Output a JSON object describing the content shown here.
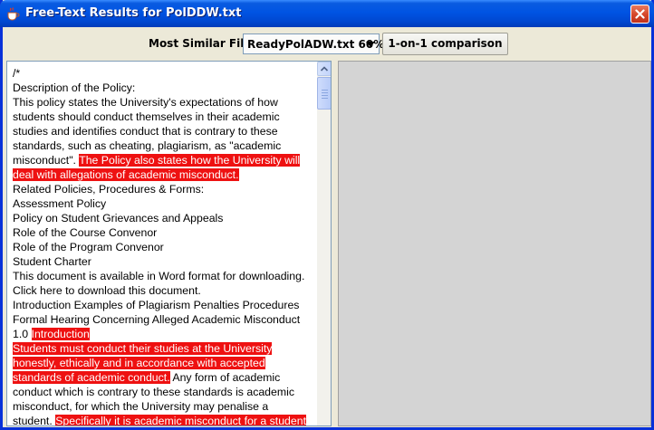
{
  "window": {
    "title": "Free-Text Results for PolDDW.txt"
  },
  "toolbar": {
    "similar_label": "Most Similar Files:",
    "selected_file": "ReadyPolADW.txt 60%",
    "compare_button": "1-on-1 comparison"
  },
  "document": {
    "segments": [
      {
        "text": "/*",
        "highlighted": false,
        "break_after": true
      },
      {
        "text": "Description of the Policy:",
        "highlighted": false,
        "break_after": true
      },
      {
        "text": "This policy states the University's expectations of how students should conduct themselves in their academic studies and identifies conduct that is contrary to these standards, such as cheating, plagiarism, as \"academic misconduct\".",
        "highlighted": false,
        "break_after": false
      },
      {
        "text": "The Policy also states how the University will deal with allegations of academic misconduct.",
        "highlighted": true,
        "break_after": true
      },
      {
        "text": "Related Policies, Procedures & Forms:",
        "highlighted": false,
        "break_after": true
      },
      {
        "text": "Assessment Policy",
        "highlighted": false,
        "break_after": true
      },
      {
        "text": "Policy on Student Grievances and Appeals",
        "highlighted": false,
        "break_after": true
      },
      {
        "text": "Role of the Course Convenor",
        "highlighted": false,
        "break_after": true
      },
      {
        "text": "Role of the Program Convenor",
        "highlighted": false,
        "break_after": true
      },
      {
        "text": "Student Charter",
        "highlighted": false,
        "break_after": true
      },
      {
        "text": "This document is available in Word format for downloading.",
        "highlighted": false,
        "break_after": true
      },
      {
        "text": "Click here to download this document.",
        "highlighted": false,
        "break_after": true
      },
      {
        "text": "Introduction Examples of Plagiarism Penalties Procedures Formal Hearing Concerning Alleged Academic Misconduct 1.0",
        "highlighted": false,
        "break_after": false
      },
      {
        "text": "Introduction",
        "highlighted": true,
        "break_after": true
      },
      {
        "text": "Students must conduct their studies at the University honestly, ethically and in accordance with accepted standards of academic conduct.",
        "highlighted": true,
        "break_after": false
      },
      {
        "text": "Any form of academic conduct which is contrary to these standards is academic misconduct, for which the University may penalise a student.",
        "highlighted": false,
        "break_after": false
      },
      {
        "text": "Specifically it is academic misconduct for a student",
        "highlighted": true,
        "break_after": false
      }
    ]
  },
  "colors": {
    "highlight": "#ee1111",
    "title_bar": "#0054e3",
    "window_bg": "#ece9d8",
    "right_pane_bg": "#d4d4d4"
  },
  "icons": {
    "app_icon": "coffee-cup-icon",
    "close": "close-icon",
    "dropdown": "chevron-down-icon",
    "scroll_up": "arrow-up-icon"
  }
}
